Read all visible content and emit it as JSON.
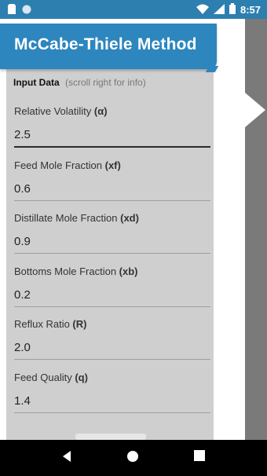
{
  "status_bar": {
    "time": "8:57"
  },
  "header": {
    "title": "McCabe-Thiele Method"
  },
  "section": {
    "title": "Input Data",
    "hint": "(scroll right for info)"
  },
  "fields": [
    {
      "label": "Relative Volatility ",
      "symbol": "(α)",
      "value": "2.5"
    },
    {
      "label": "Feed Mole Fraction ",
      "symbol": "(xf)",
      "value": "0.6"
    },
    {
      "label": "Distillate Mole Fraction ",
      "symbol": "(xd)",
      "value": "0.9"
    },
    {
      "label": "Bottoms Mole Fraction ",
      "symbol": "(xb)",
      "value": "0.2"
    },
    {
      "label": "Reflux Ratio ",
      "symbol": "(R)",
      "value": "2.0"
    },
    {
      "label": "Feed Quality ",
      "symbol": "(q)",
      "value": "1.4"
    }
  ],
  "colors": {
    "accent": "#2d86bd",
    "status_bar": "#2d7fb0",
    "sheet": "#cfcfcf",
    "right_panel": "#7a7a7a"
  },
  "icons": {
    "status_left": [
      "sim-card-icon",
      "circle-icon"
    ],
    "status_right": [
      "wifi-icon",
      "signal-icon",
      "battery-icon"
    ],
    "nav": [
      "back-icon",
      "home-icon",
      "recents-icon"
    ]
  }
}
